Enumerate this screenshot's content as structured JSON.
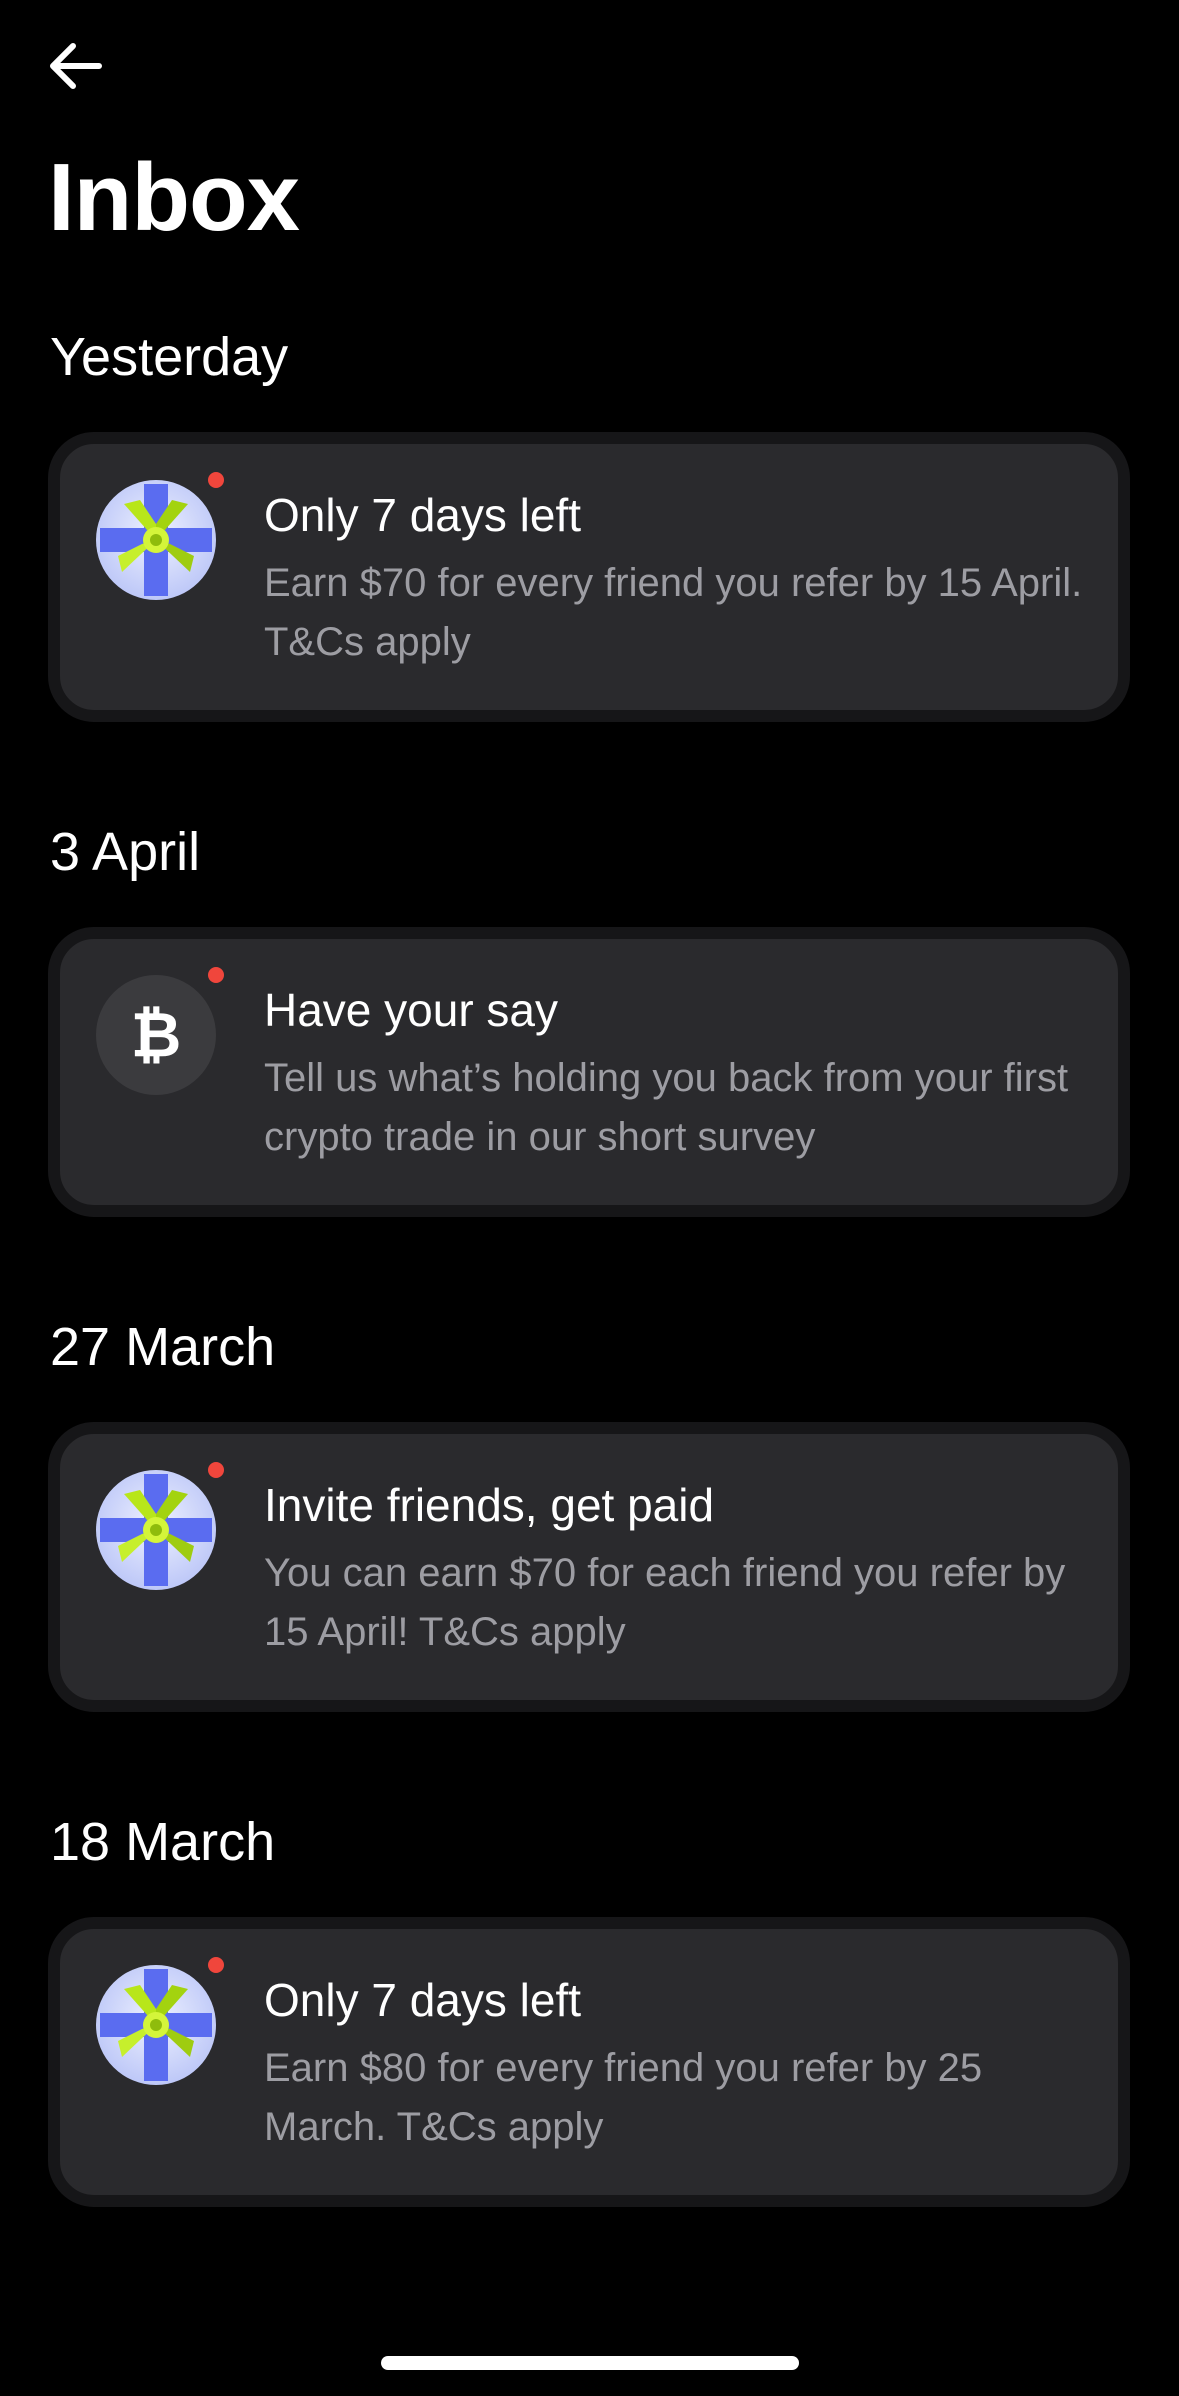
{
  "header": {
    "back_icon": "arrow-left-icon",
    "title": "Inbox"
  },
  "colors": {
    "background": "#000000",
    "card": "#2a2a2d",
    "unread_dot": "#f0463c",
    "secondary_text": "#9d9da3"
  },
  "sections": [
    {
      "date": "Yesterday",
      "message": {
        "icon": "gift-icon",
        "unread": true,
        "title": "Only 7 days left",
        "body": "Earn $70 for every friend you refer by 15 April. T&Cs apply"
      }
    },
    {
      "date": "3 April",
      "message": {
        "icon": "bitcoin-icon",
        "icon_glyph": "₿",
        "unread": true,
        "title": "Have your say",
        "body": "Tell us what’s holding you back from your first crypto trade in our short survey"
      }
    },
    {
      "date": "27 March",
      "message": {
        "icon": "gift-icon",
        "unread": true,
        "title": "Invite friends, get paid",
        "body": "You can earn $70 for each friend you refer by 15 April! T&Cs apply"
      }
    },
    {
      "date": "18 March",
      "message": {
        "icon": "gift-icon",
        "unread": true,
        "title": "Only 7 days left",
        "body": "Earn $80 for every friend you refer by 25 March. T&Cs apply"
      }
    }
  ]
}
